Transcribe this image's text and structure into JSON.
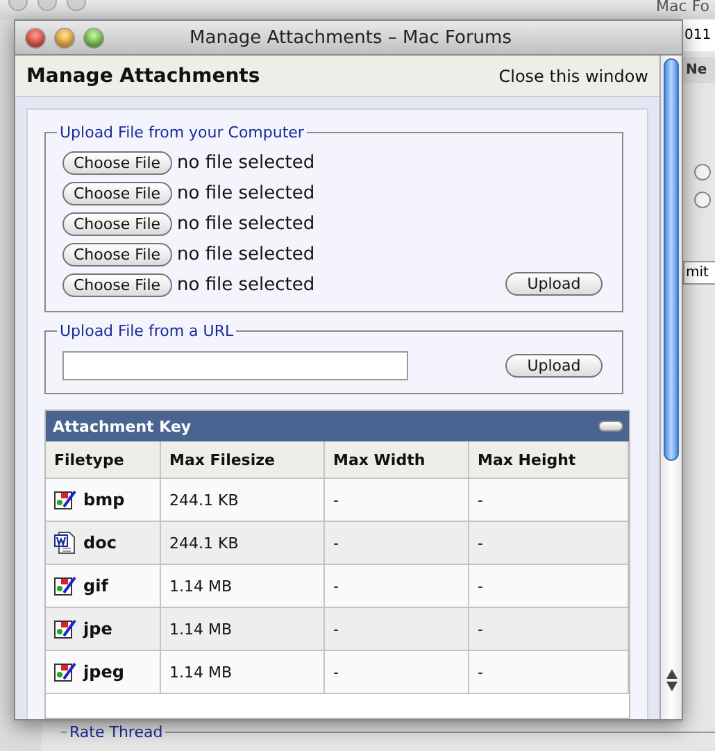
{
  "background_window": {
    "title": "Mac Fo",
    "field_text": "011",
    "tab": "Ne",
    "button": "mit",
    "section_legend": "Rate Thread",
    "radios": [
      {
        "selected": false
      },
      {
        "selected": false
      }
    ]
  },
  "window": {
    "title": "Manage Attachments – Mac Forums"
  },
  "header": {
    "title": "Manage Attachments",
    "close_link": "Close this window"
  },
  "upload_computer": {
    "legend": "Upload File from your Computer",
    "files": [
      {
        "button": "Choose File",
        "status": "no file selected"
      },
      {
        "button": "Choose File",
        "status": "no file selected"
      },
      {
        "button": "Choose File",
        "status": "no file selected"
      },
      {
        "button": "Choose File",
        "status": "no file selected"
      },
      {
        "button": "Choose File",
        "status": "no file selected"
      }
    ],
    "upload_button": "Upload"
  },
  "upload_url": {
    "legend": "Upload File from a URL",
    "upload_button": "Upload"
  },
  "attachment_key": {
    "title": "Attachment Key",
    "columns": [
      "Filetype",
      "Max Filesize",
      "Max Width",
      "Max Height"
    ],
    "rows": [
      {
        "kind": "image",
        "filetype": "bmp",
        "max_filesize": "244.1 KB",
        "max_width": "-",
        "max_height": "-"
      },
      {
        "kind": "document",
        "filetype": "doc",
        "max_filesize": "244.1 KB",
        "max_width": "-",
        "max_height": "-"
      },
      {
        "kind": "image",
        "filetype": "gif",
        "max_filesize": "1.14 MB",
        "max_width": "-",
        "max_height": "-"
      },
      {
        "kind": "image",
        "filetype": "jpe",
        "max_filesize": "1.14 MB",
        "max_width": "-",
        "max_height": "-"
      },
      {
        "kind": "image",
        "filetype": "jpeg",
        "max_filesize": "1.14 MB",
        "max_width": "-",
        "max_height": "-"
      }
    ]
  }
}
